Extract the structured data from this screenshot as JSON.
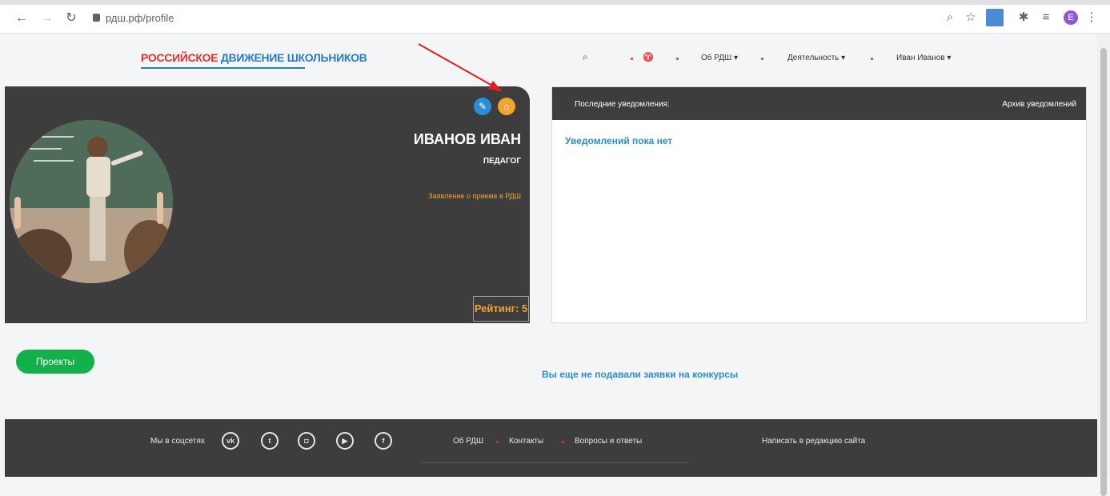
{
  "browser": {
    "url": "рдш.рф/profile",
    "profile_initial": "E",
    "icons": [
      "back-icon",
      "forward-icon",
      "reload-icon",
      "lock-icon",
      "zoom-icon",
      "star-icon",
      "extension-new-icon",
      "puzzle-icon",
      "reading-list-icon",
      "profile-avatar",
      "menu-icon"
    ]
  },
  "site": {
    "logo_red": "РОССИЙСКОЕ",
    "logo_blue": "ДВИЖЕНИЕ ШКОЛЬНИКОВ",
    "menu": {
      "about": "Об РДШ ▾",
      "activity": "Деятельность ▾",
      "user": "Иван Иванов ▾"
    }
  },
  "profile": {
    "name": "ИВАНОВ ИВАН",
    "role": "ПЕДАГОГ",
    "application_link": "Заявление о приеме в РДШ",
    "rating": "Рейтинг: 5"
  },
  "notifications": {
    "title": "Последние уведомления:",
    "archive": "Архив уведомлений",
    "empty": "Уведомлений пока нет"
  },
  "projects": {
    "button": "Проекты",
    "message": "Вы еще не подавали заявки на конкурсы"
  },
  "footer": {
    "social_label": "Мы в соцсетях",
    "social": [
      "vk-icon",
      "twitter-icon",
      "instagram-icon",
      "youtube-icon",
      "facebook-icon"
    ],
    "links": [
      "Об РДШ",
      "Контакты",
      "Вопросы и ответы"
    ],
    "write": "Написать в редакцию сайта"
  },
  "colors": {
    "dark": "#3d3d3d",
    "accent_orange": "#f0a431",
    "accent_blue": "#2a8fd1",
    "green": "#14b04c",
    "red": "#e4322b"
  }
}
